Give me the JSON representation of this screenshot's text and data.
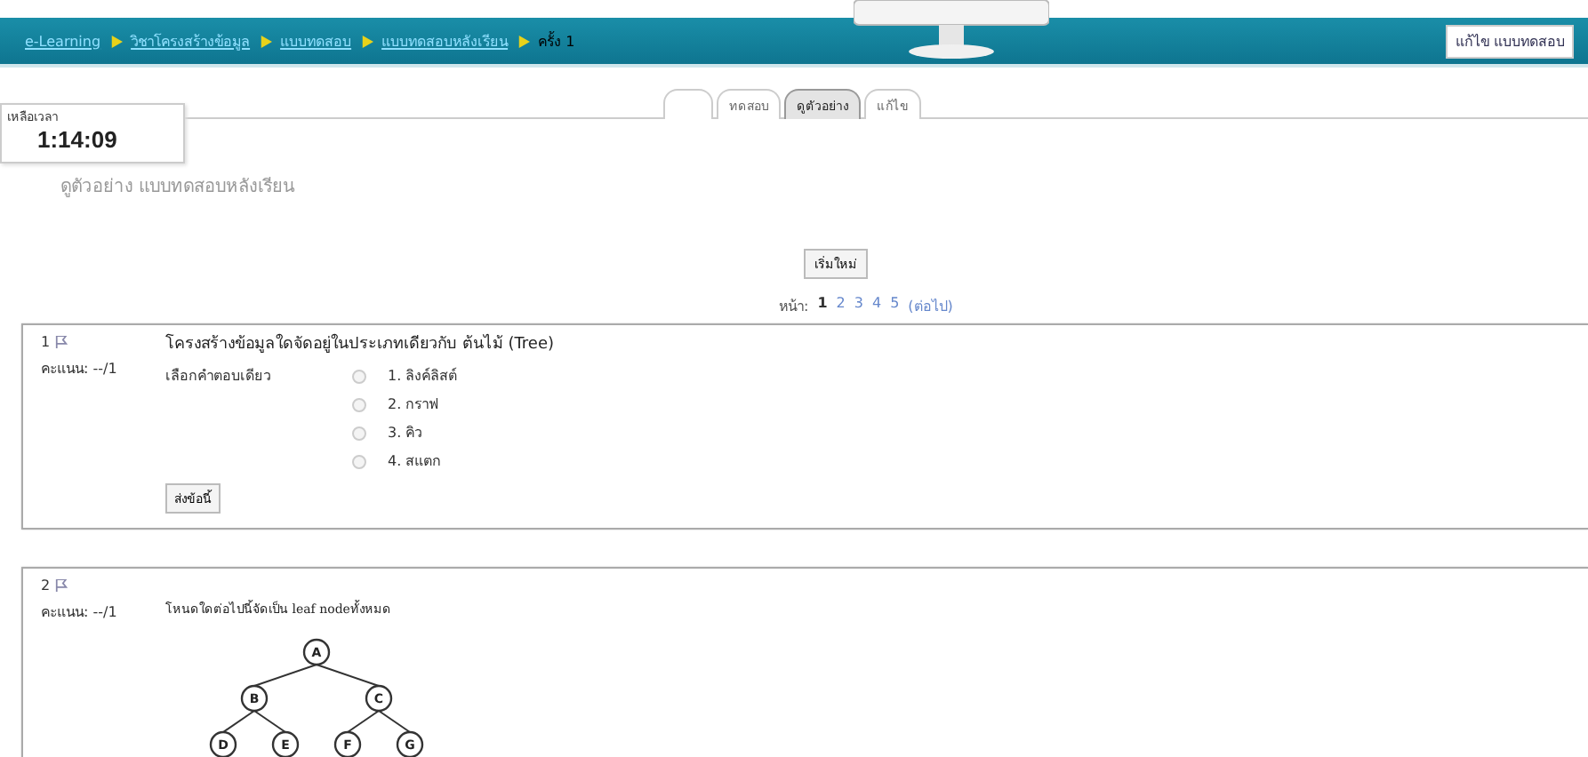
{
  "breadcrumb": [
    {
      "label": "e-Learning",
      "link": true
    },
    {
      "label": "วิชาโครงสร้างข้อมูล",
      "link": true
    },
    {
      "label": "แบบทดสอบ",
      "link": true
    },
    {
      "label": "แบบทดสอบหลังเรียน",
      "link": true
    },
    {
      "label": "ครั้ง 1",
      "link": false
    }
  ],
  "header_button": "แก้ไข แบบทดสอบ",
  "tabs": [
    {
      "selected": false
    },
    {
      "label": "ทดสอบ",
      "selected": false
    },
    {
      "label": "ดูตัวอย่าง",
      "selected": true
    },
    {
      "label": "แก้ไข",
      "selected": false
    }
  ],
  "timer": {
    "label": "เหลือเวลา",
    "value": "1:14:09"
  },
  "title": "ดูตัวอย่าง แบบทดสอบหลังเรียน",
  "restart_button": "เริ่มใหม่",
  "pager": {
    "label": "หน้า:",
    "pages": [
      {
        "label": "1",
        "selected": true
      },
      {
        "label": "2",
        "selected": false
      },
      {
        "label": "3",
        "selected": false
      },
      {
        "label": "4",
        "selected": false
      },
      {
        "label": "5",
        "selected": false
      }
    ],
    "next": "(ต่อไป)"
  },
  "questions": [
    {
      "number": "1",
      "score": "คะแนน: --/1",
      "text": "โครงสร้างข้อมูลใดจัดอยู่ในประเภทเดียวกับ ต้นไม้ (Tree)",
      "kind": "choice",
      "instruction": "เลือกคำตอบเดียว",
      "options": [
        {
          "label": "1. ลิงค์ลิสต์",
          "selected": false
        },
        {
          "label": "2. กราฟ",
          "selected": false
        },
        {
          "label": "3. คิว",
          "selected": false
        },
        {
          "label": "4. สแตก",
          "selected": false
        }
      ],
      "submit": "ส่งข้อนี้"
    },
    {
      "number": "2",
      "score": "คะแนน: --/1",
      "text": "โหนดใดต่อไปนี้จัดเป็น leaf nodeทั้งหมด",
      "kind": "tree",
      "tree": {
        "label": "A",
        "children": [
          {
            "label": "B",
            "children": [
              {
                "label": "D"
              },
              {
                "label": "E"
              }
            ]
          },
          {
            "label": "C",
            "children": [
              {
                "label": "F"
              },
              {
                "label": "G"
              }
            ]
          }
        ]
      }
    }
  ]
}
